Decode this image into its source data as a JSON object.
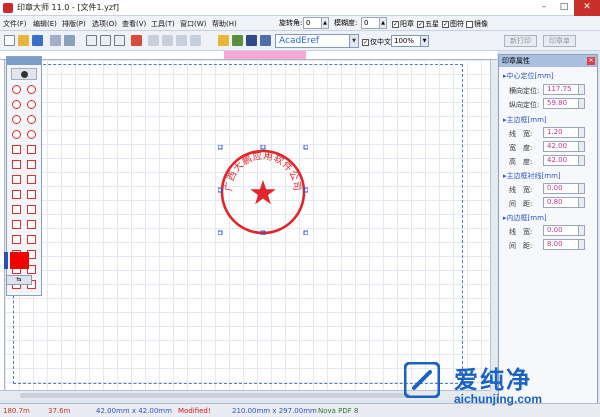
{
  "window": {
    "title": "印章大师 11.0 - [文件1.yzf]"
  },
  "menu": {
    "items": [
      "文件(F)",
      "编辑(E)",
      "排版(P)",
      "选项(O)",
      "查看(V)",
      "工具(T)",
      "窗口(W)",
      "帮助(H)"
    ],
    "rotate_label": "旋转角:",
    "rotate_value": "0",
    "blur_label": "模糊度:",
    "blur_value": "0",
    "checks": [
      {
        "label": "阳章",
        "checked": true
      },
      {
        "label": "五星",
        "checked": true
      },
      {
        "label": "图符",
        "checked": true
      },
      {
        "label": "镜像",
        "checked": false
      }
    ]
  },
  "toolbar": {
    "font": "AcadEref",
    "only_chinese": "仅中文",
    "zoom": "100%",
    "btn_seal_plan": "新打印",
    "btn_print": "印章单"
  },
  "seal": {
    "text": "广西大鹏应用软件公司",
    "color": "#e0262b"
  },
  "props": {
    "title": "印章属性",
    "sections": [
      {
        "name": "中心定位[mm]",
        "rows": [
          {
            "label": "横向定位:",
            "value": "117.75"
          },
          {
            "label": "纵向定位:",
            "value": "59.80"
          }
        ]
      },
      {
        "name": "主边框[mm]",
        "rows": [
          {
            "label": "线　宽:",
            "value": "1.20"
          },
          {
            "label": "宽　度:",
            "value": "42.00"
          },
          {
            "label": "高　度:",
            "value": "42.00"
          }
        ]
      },
      {
        "name": "主边框衬线[mm]",
        "rows": [
          {
            "label": "线　宽:",
            "value": "0.00"
          },
          {
            "label": "间　距:",
            "value": "0.80"
          }
        ]
      },
      {
        "name": "内边框[mm]",
        "rows": [
          {
            "label": "线　宽:",
            "value": "0.00"
          },
          {
            "label": "间　距:",
            "value": "8.00"
          }
        ]
      }
    ]
  },
  "status": {
    "coord_x": "180.7m",
    "coord_y": "37.6m",
    "size": "42.00mm x 42.00mm",
    "modified": "Modified!",
    "paper": "210.00mm x 297.00mm",
    "printer": "Nova PDF 8"
  },
  "watermark": {
    "text_cn": "爱纯净",
    "url": "aichunjing.com"
  },
  "colors": {
    "accent": "#2b57c2",
    "seal_red": "#e0262b",
    "value_pink": "#c4329c"
  }
}
